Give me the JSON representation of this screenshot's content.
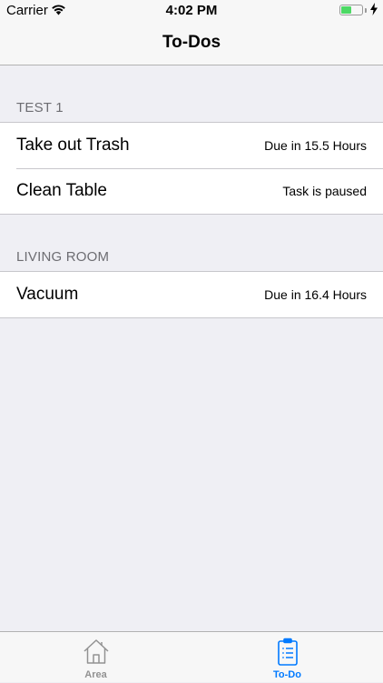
{
  "status_bar": {
    "carrier": "Carrier",
    "time": "4:02 PM",
    "battery_level": 0.5,
    "battery_color": "#4cd964"
  },
  "nav": {
    "title": "To-Dos"
  },
  "sections": [
    {
      "header": "TEST 1",
      "items": [
        {
          "title": "Take out Trash",
          "detail": "Due in 15.5 Hours"
        },
        {
          "title": "Clean Table",
          "detail": "Task is paused"
        }
      ]
    },
    {
      "header": "LIVING ROOM",
      "items": [
        {
          "title": "Vacuum",
          "detail": "Due in 16.4 Hours"
        }
      ]
    }
  ],
  "tab_bar": {
    "tabs": [
      {
        "label": "Area",
        "icon": "house-icon",
        "selected": false
      },
      {
        "label": "To-Do",
        "icon": "clipboard-list-icon",
        "selected": true
      }
    ],
    "active_color": "#007aff",
    "inactive_color": "#929292"
  }
}
